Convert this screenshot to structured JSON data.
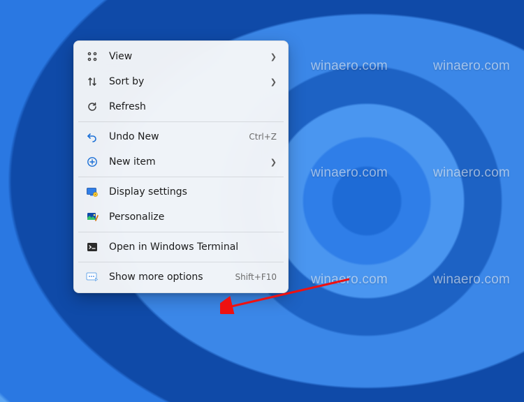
{
  "watermark_text": "winaero.com",
  "menu": {
    "view": {
      "label": "View",
      "has_submenu": true
    },
    "sort_by": {
      "label": "Sort by",
      "has_submenu": true
    },
    "refresh": {
      "label": "Refresh"
    },
    "undo": {
      "label": "Undo New",
      "shortcut": "Ctrl+Z"
    },
    "new_item": {
      "label": "New item",
      "has_submenu": true
    },
    "display": {
      "label": "Display settings"
    },
    "personalize": {
      "label": "Personalize"
    },
    "terminal": {
      "label": "Open in Windows Terminal"
    },
    "more": {
      "label": "Show more options",
      "shortcut": "Shift+F10"
    }
  }
}
